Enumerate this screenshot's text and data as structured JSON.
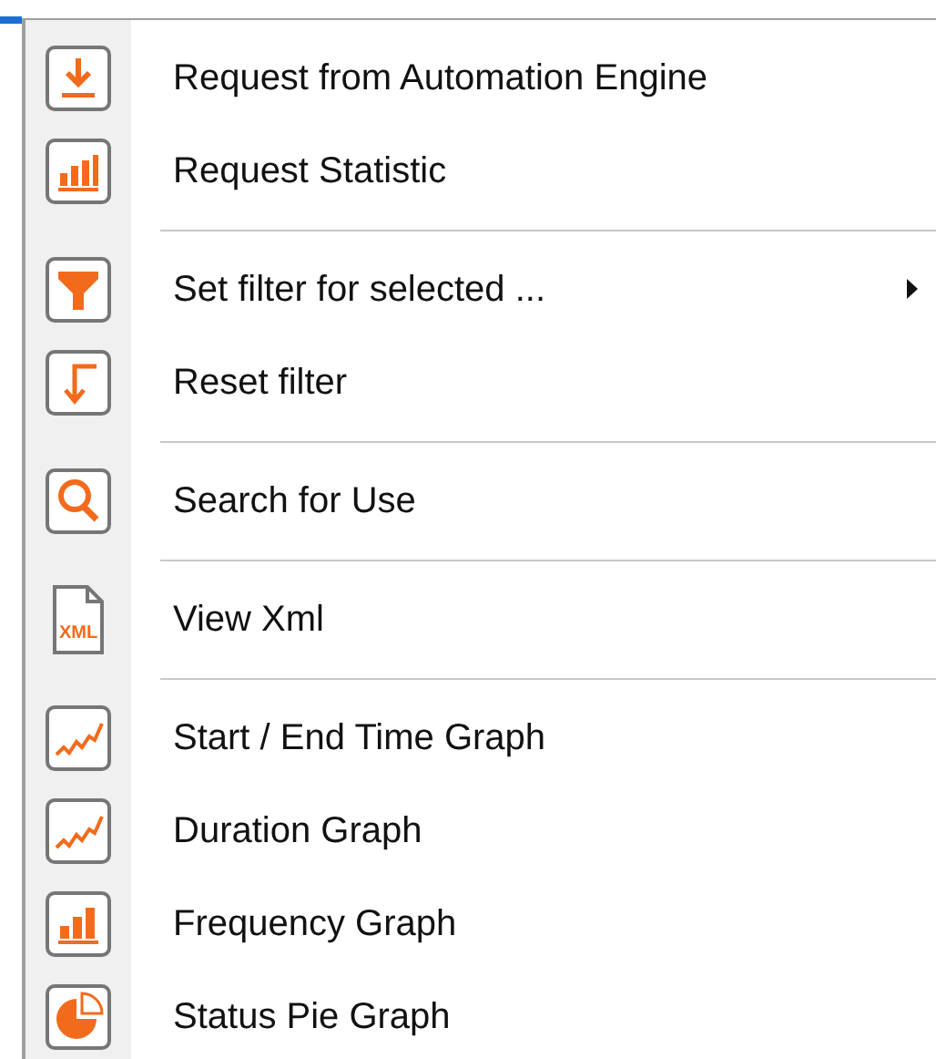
{
  "menu": {
    "items": [
      {
        "kind": "item",
        "label": "Request from Automation Engine"
      },
      {
        "kind": "item",
        "label": "Request Statistic"
      },
      {
        "kind": "separator"
      },
      {
        "kind": "item",
        "label": "Set filter for selected ...",
        "submenu": true
      },
      {
        "kind": "item",
        "label": "Reset filter"
      },
      {
        "kind": "separator"
      },
      {
        "kind": "item",
        "label": "Search for Use"
      },
      {
        "kind": "separator"
      },
      {
        "kind": "item",
        "icon_text": "XML",
        "label": "View Xml"
      },
      {
        "kind": "separator"
      },
      {
        "kind": "item",
        "label": "Start / End Time Graph"
      },
      {
        "kind": "item",
        "label": "Duration Graph"
      },
      {
        "kind": "item",
        "label": "Frequency Graph"
      },
      {
        "kind": "item",
        "label": "Status Pie Graph"
      }
    ]
  }
}
